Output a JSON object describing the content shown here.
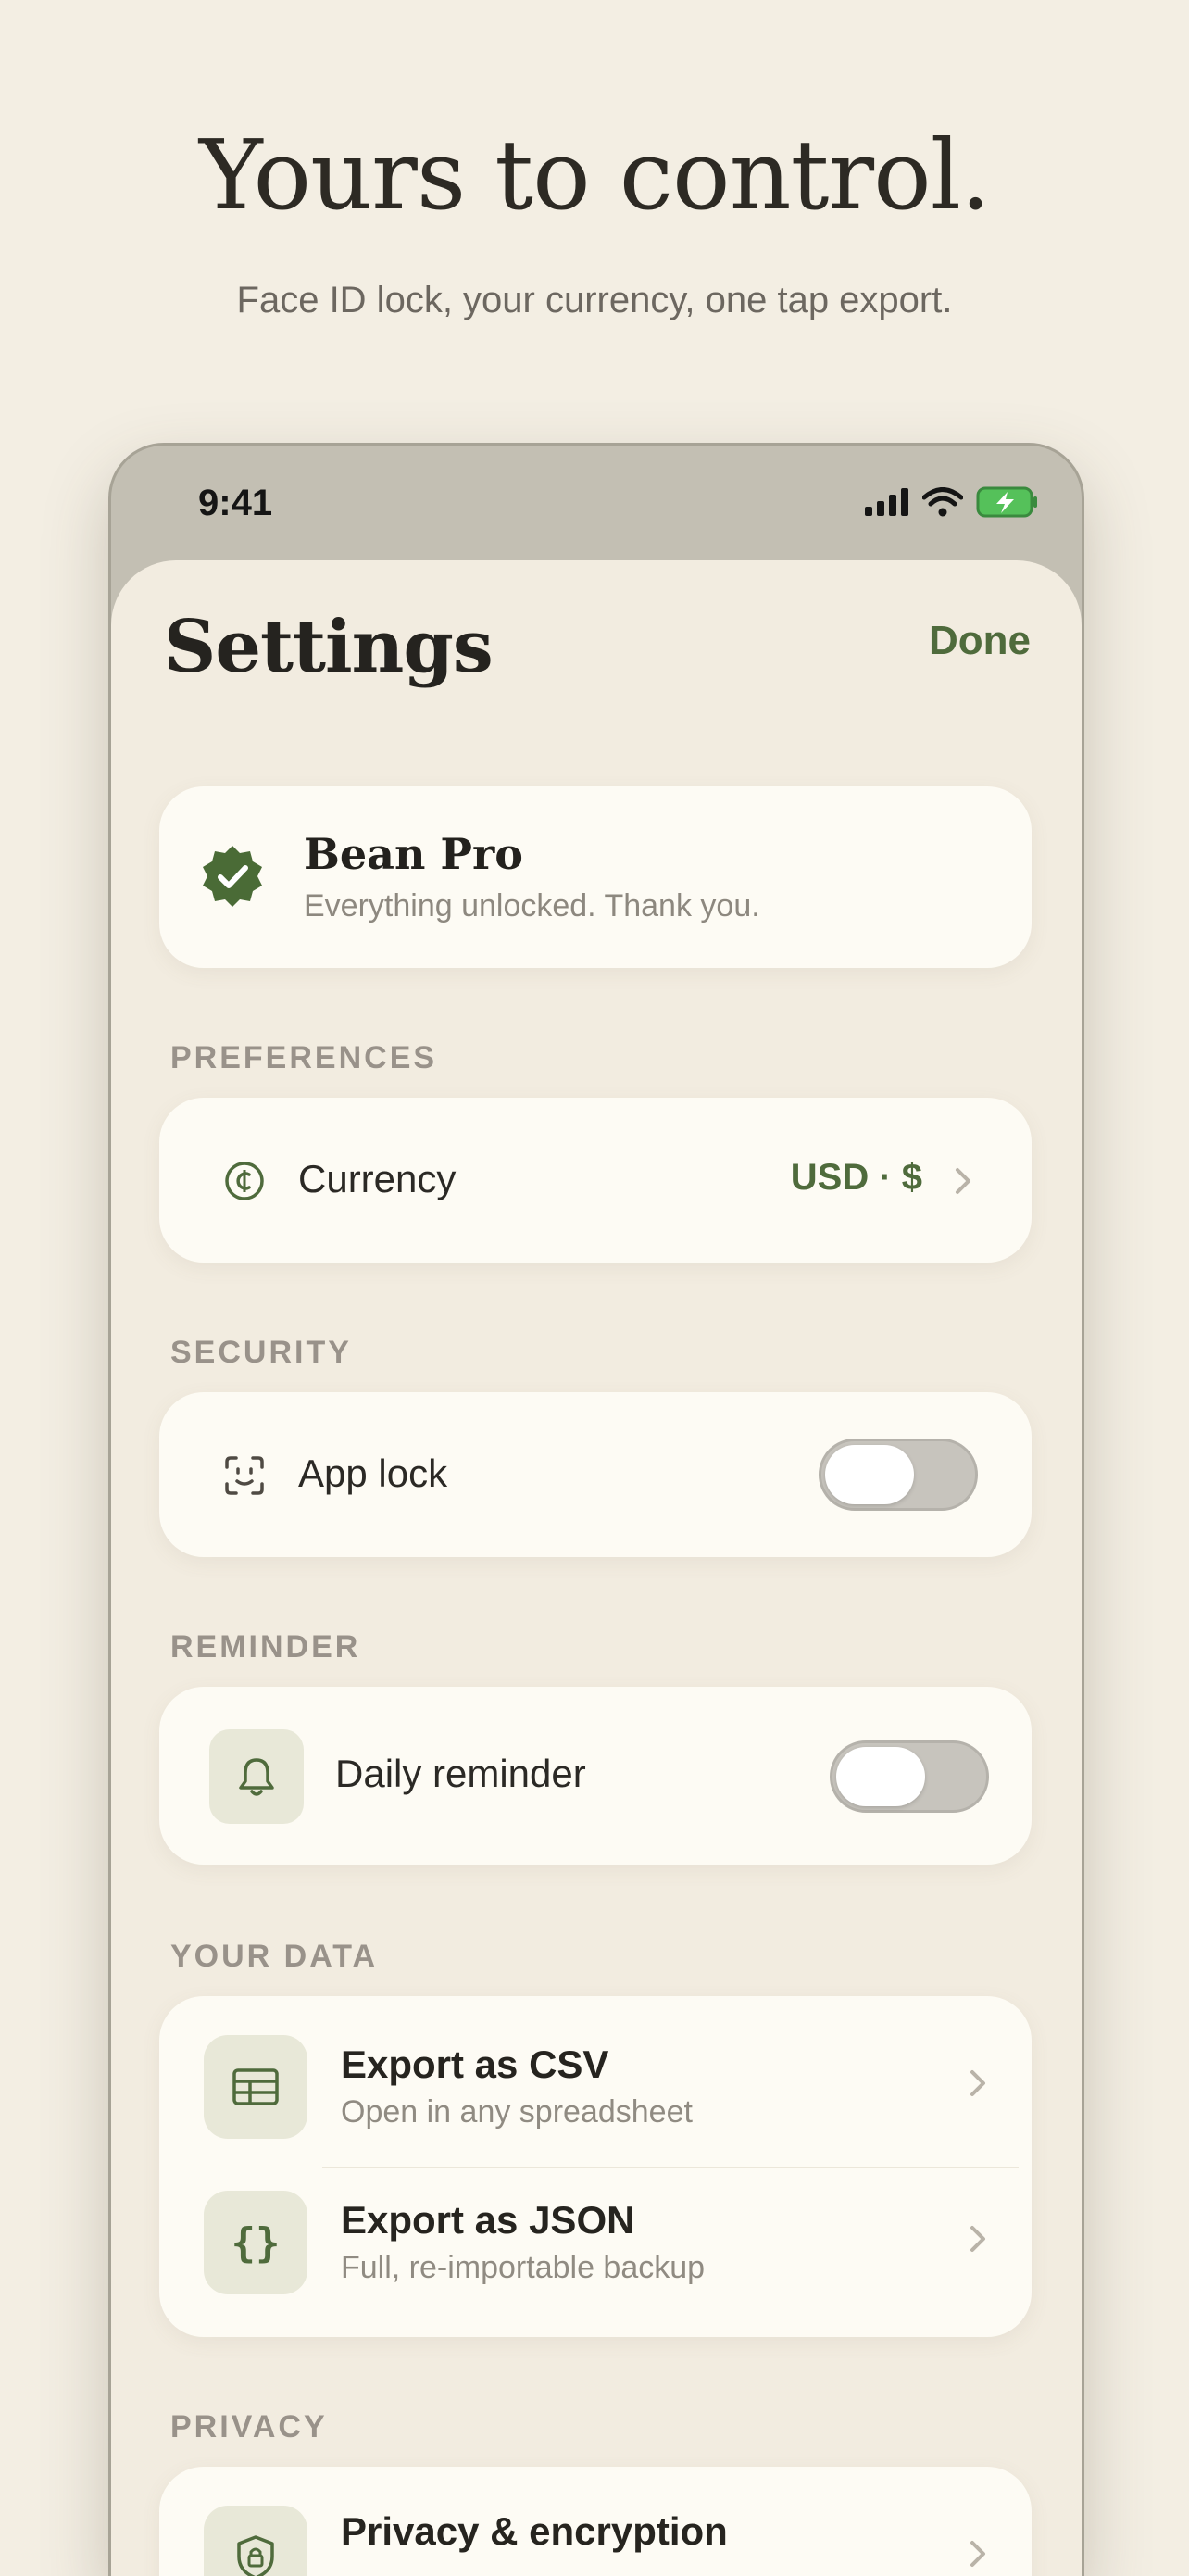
{
  "hero": {
    "title": "Yours to control.",
    "subtitle": "Face ID lock, your currency, one tap export."
  },
  "status_bar": {
    "time": "9:41",
    "icons": [
      "cellular-signal-icon",
      "wifi-icon",
      "battery-charging-icon"
    ]
  },
  "settings": {
    "title": "Settings",
    "done_label": "Done",
    "pro": {
      "title": "Bean Pro",
      "subtitle": "Everything unlocked. Thank you.",
      "icon": "verified-badge-icon"
    },
    "preferences": {
      "section_label": "PREFERENCES",
      "currency_label": "Currency",
      "currency_value": "USD · $",
      "icon": "currency-cent-icon"
    },
    "security": {
      "section_label": "SECURITY",
      "app_lock_label": "App lock",
      "app_lock_on": false,
      "icon": "face-id-icon"
    },
    "reminder": {
      "section_label": "REMINDER",
      "daily_label": "Daily reminder",
      "daily_on": false,
      "icon": "bell-icon"
    },
    "your_data": {
      "section_label": "YOUR DATA",
      "items": [
        {
          "title": "Export as CSV",
          "subtitle": "Open in any spreadsheet",
          "icon": "table-icon"
        },
        {
          "title": "Export as JSON",
          "subtitle": "Full, re-importable backup",
          "icon": "braces-icon"
        }
      ]
    },
    "privacy": {
      "section_label": "PRIVACY",
      "item_title": "Privacy & encryption",
      "icon": "shield-lock-icon"
    }
  },
  "colors": {
    "background": "#f3eee3",
    "accent": "#4f6b3c",
    "card": "#fdfbf4",
    "icon_tile": "#e8e8d8"
  }
}
